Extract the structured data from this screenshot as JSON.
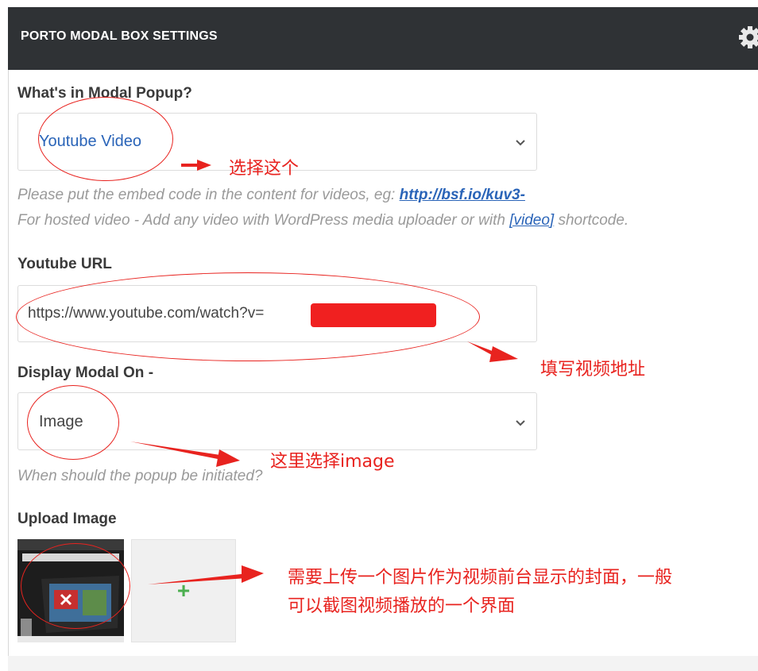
{
  "header": {
    "title": "PORTO MODAL BOX SETTINGS",
    "settings_icon": "gear-icon"
  },
  "modal_popup": {
    "label": "What's in Modal Popup?",
    "selected": "Youtube Video",
    "help_line1_prefix": "Please put the embed code in the content for videos, eg:",
    "help_link": "http://bsf.io/kuv3-",
    "help_line2_prefix": "For hosted video - Add any video with WordPress media uploader or with",
    "help_video_link": "[video]",
    "help_line2_suffix": "shortcode."
  },
  "youtube_url": {
    "label": "Youtube URL",
    "value": "https://www.youtube.com/watch?v="
  },
  "display_on": {
    "label": "Display Modal On -",
    "selected": "Image",
    "help": "When should the popup be initiated?"
  },
  "upload_image": {
    "label": "Upload Image",
    "add_symbol": "+"
  },
  "annotations": {
    "select_this": "选择这个",
    "fill_video_url": "填写视频地址",
    "select_image_here": "这里选择image",
    "upload_note_line1": "需要上传一个图片作为视频前台显示的封面，一般",
    "upload_note_line2": "可以截图视频播放的一个界面"
  },
  "colors": {
    "accent_red": "#e8231f",
    "header_bg": "#2f3235",
    "link": "#2a64b8",
    "plus": "#4caf50"
  }
}
